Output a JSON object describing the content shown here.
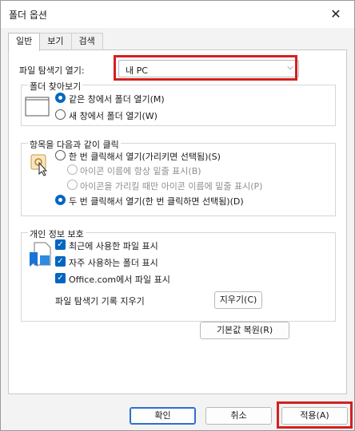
{
  "window": {
    "title": "폴더 옵션",
    "close_glyph": "✕"
  },
  "tabs": [
    {
      "label": "일반"
    },
    {
      "label": "보기"
    },
    {
      "label": "검색"
    }
  ],
  "open_explorer": {
    "label": "파일 탐색기 열기:",
    "value": "내 PC",
    "chevron": "⌵"
  },
  "browse_folders": {
    "title": "폴더 찾아보기",
    "options": [
      "같은 창에서 폴더 열기(M)",
      "새 창에서 폴더 열기(W)"
    ]
  },
  "click_items": {
    "title": "항목을 다음과 같이 클릭",
    "options": [
      "한 번 클릭해서 열기(가리키면 선택됨)(S)",
      "아이콘 이름에 항상 밑줄 표시(B)",
      "아이콘을 가리킬 때만 아이콘 이름에 밑줄 표시(P)",
      "두 번 클릭해서 열기(한 번 클릭하면 선택됨)(D)"
    ]
  },
  "privacy": {
    "title": "개인 정보 보호",
    "options": [
      "최근에 사용한 파일 표시",
      "자주 사용하는 폴더 표시",
      "Office.com에서 파일 표시"
    ],
    "clear_label": "파일 탐색기 기록 지우기",
    "clear_button": "지우기(C)"
  },
  "restore_defaults": "기본값 복원(R)",
  "footer": {
    "ok": "확인",
    "cancel": "취소",
    "apply": "적용(A)"
  },
  "colors": {
    "accent": "#0067c0",
    "highlight_box": "#d42020"
  }
}
